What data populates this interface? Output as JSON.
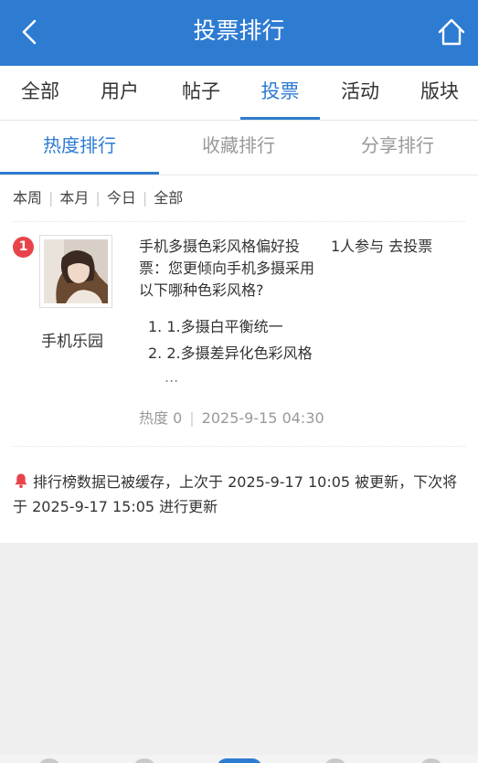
{
  "header": {
    "title": "投票排行",
    "back_icon": "chevron-left-icon",
    "home_icon": "home-icon",
    "color": "#2e7bd2"
  },
  "main_tabs": [
    {
      "label": "全部"
    },
    {
      "label": "用户"
    },
    {
      "label": "帖子"
    },
    {
      "label": "投票",
      "active": true
    },
    {
      "label": "活动"
    },
    {
      "label": "版块"
    }
  ],
  "sub_tabs": [
    {
      "label": "热度排行",
      "active": true
    },
    {
      "label": "收藏排行"
    },
    {
      "label": "分享排行"
    }
  ],
  "periods": [
    "本周",
    "本月",
    "今日",
    "全部"
  ],
  "items": [
    {
      "rank": "1",
      "author": "手机乐园",
      "title": "手机多摄色彩风格偏好投票：您更倾向手机多摄采用以下哪种色彩风格?",
      "participants": "1人参与",
      "vote_link": "去投票",
      "options": [
        "1.多摄白平衡统一",
        "2.多摄差异化色彩风格"
      ],
      "more": "...",
      "heat": "热度 0",
      "time": "2025-9-15 04:30"
    }
  ],
  "notice": {
    "icon": "bell-icon",
    "text": "排行榜数据已被缓存，上次于 2025-9-17 10:05 被更新，下次将于 2025-9-17 15:05 进行更新"
  },
  "colors": {
    "accent": "#2e7bd2",
    "rank_badge": "#e8434b",
    "bell": "#e8434b"
  }
}
